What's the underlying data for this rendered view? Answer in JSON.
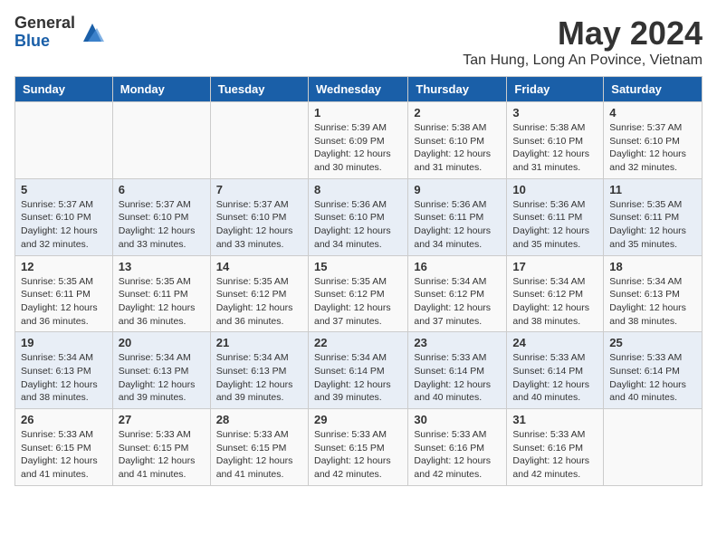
{
  "logo": {
    "general": "General",
    "blue": "Blue"
  },
  "title": "May 2024",
  "subtitle": "Tan Hung, Long An Povince, Vietnam",
  "headers": [
    "Sunday",
    "Monday",
    "Tuesday",
    "Wednesday",
    "Thursday",
    "Friday",
    "Saturday"
  ],
  "weeks": [
    [
      {
        "day": "",
        "sunrise": "",
        "sunset": "",
        "daylight": ""
      },
      {
        "day": "",
        "sunrise": "",
        "sunset": "",
        "daylight": ""
      },
      {
        "day": "",
        "sunrise": "",
        "sunset": "",
        "daylight": ""
      },
      {
        "day": "1",
        "sunrise": "Sunrise: 5:39 AM",
        "sunset": "Sunset: 6:09 PM",
        "daylight": "Daylight: 12 hours and 30 minutes."
      },
      {
        "day": "2",
        "sunrise": "Sunrise: 5:38 AM",
        "sunset": "Sunset: 6:10 PM",
        "daylight": "Daylight: 12 hours and 31 minutes."
      },
      {
        "day": "3",
        "sunrise": "Sunrise: 5:38 AM",
        "sunset": "Sunset: 6:10 PM",
        "daylight": "Daylight: 12 hours and 31 minutes."
      },
      {
        "day": "4",
        "sunrise": "Sunrise: 5:37 AM",
        "sunset": "Sunset: 6:10 PM",
        "daylight": "Daylight: 12 hours and 32 minutes."
      }
    ],
    [
      {
        "day": "5",
        "sunrise": "Sunrise: 5:37 AM",
        "sunset": "Sunset: 6:10 PM",
        "daylight": "Daylight: 12 hours and 32 minutes."
      },
      {
        "day": "6",
        "sunrise": "Sunrise: 5:37 AM",
        "sunset": "Sunset: 6:10 PM",
        "daylight": "Daylight: 12 hours and 33 minutes."
      },
      {
        "day": "7",
        "sunrise": "Sunrise: 5:37 AM",
        "sunset": "Sunset: 6:10 PM",
        "daylight": "Daylight: 12 hours and 33 minutes."
      },
      {
        "day": "8",
        "sunrise": "Sunrise: 5:36 AM",
        "sunset": "Sunset: 6:10 PM",
        "daylight": "Daylight: 12 hours and 34 minutes."
      },
      {
        "day": "9",
        "sunrise": "Sunrise: 5:36 AM",
        "sunset": "Sunset: 6:11 PM",
        "daylight": "Daylight: 12 hours and 34 minutes."
      },
      {
        "day": "10",
        "sunrise": "Sunrise: 5:36 AM",
        "sunset": "Sunset: 6:11 PM",
        "daylight": "Daylight: 12 hours and 35 minutes."
      },
      {
        "day": "11",
        "sunrise": "Sunrise: 5:35 AM",
        "sunset": "Sunset: 6:11 PM",
        "daylight": "Daylight: 12 hours and 35 minutes."
      }
    ],
    [
      {
        "day": "12",
        "sunrise": "Sunrise: 5:35 AM",
        "sunset": "Sunset: 6:11 PM",
        "daylight": "Daylight: 12 hours and 36 minutes."
      },
      {
        "day": "13",
        "sunrise": "Sunrise: 5:35 AM",
        "sunset": "Sunset: 6:11 PM",
        "daylight": "Daylight: 12 hours and 36 minutes."
      },
      {
        "day": "14",
        "sunrise": "Sunrise: 5:35 AM",
        "sunset": "Sunset: 6:12 PM",
        "daylight": "Daylight: 12 hours and 36 minutes."
      },
      {
        "day": "15",
        "sunrise": "Sunrise: 5:35 AM",
        "sunset": "Sunset: 6:12 PM",
        "daylight": "Daylight: 12 hours and 37 minutes."
      },
      {
        "day": "16",
        "sunrise": "Sunrise: 5:34 AM",
        "sunset": "Sunset: 6:12 PM",
        "daylight": "Daylight: 12 hours and 37 minutes."
      },
      {
        "day": "17",
        "sunrise": "Sunrise: 5:34 AM",
        "sunset": "Sunset: 6:12 PM",
        "daylight": "Daylight: 12 hours and 38 minutes."
      },
      {
        "day": "18",
        "sunrise": "Sunrise: 5:34 AM",
        "sunset": "Sunset: 6:13 PM",
        "daylight": "Daylight: 12 hours and 38 minutes."
      }
    ],
    [
      {
        "day": "19",
        "sunrise": "Sunrise: 5:34 AM",
        "sunset": "Sunset: 6:13 PM",
        "daylight": "Daylight: 12 hours and 38 minutes."
      },
      {
        "day": "20",
        "sunrise": "Sunrise: 5:34 AM",
        "sunset": "Sunset: 6:13 PM",
        "daylight": "Daylight: 12 hours and 39 minutes."
      },
      {
        "day": "21",
        "sunrise": "Sunrise: 5:34 AM",
        "sunset": "Sunset: 6:13 PM",
        "daylight": "Daylight: 12 hours and 39 minutes."
      },
      {
        "day": "22",
        "sunrise": "Sunrise: 5:34 AM",
        "sunset": "Sunset: 6:14 PM",
        "daylight": "Daylight: 12 hours and 39 minutes."
      },
      {
        "day": "23",
        "sunrise": "Sunrise: 5:33 AM",
        "sunset": "Sunset: 6:14 PM",
        "daylight": "Daylight: 12 hours and 40 minutes."
      },
      {
        "day": "24",
        "sunrise": "Sunrise: 5:33 AM",
        "sunset": "Sunset: 6:14 PM",
        "daylight": "Daylight: 12 hours and 40 minutes."
      },
      {
        "day": "25",
        "sunrise": "Sunrise: 5:33 AM",
        "sunset": "Sunset: 6:14 PM",
        "daylight": "Daylight: 12 hours and 40 minutes."
      }
    ],
    [
      {
        "day": "26",
        "sunrise": "Sunrise: 5:33 AM",
        "sunset": "Sunset: 6:15 PM",
        "daylight": "Daylight: 12 hours and 41 minutes."
      },
      {
        "day": "27",
        "sunrise": "Sunrise: 5:33 AM",
        "sunset": "Sunset: 6:15 PM",
        "daylight": "Daylight: 12 hours and 41 minutes."
      },
      {
        "day": "28",
        "sunrise": "Sunrise: 5:33 AM",
        "sunset": "Sunset: 6:15 PM",
        "daylight": "Daylight: 12 hours and 41 minutes."
      },
      {
        "day": "29",
        "sunrise": "Sunrise: 5:33 AM",
        "sunset": "Sunset: 6:15 PM",
        "daylight": "Daylight: 12 hours and 42 minutes."
      },
      {
        "day": "30",
        "sunrise": "Sunrise: 5:33 AM",
        "sunset": "Sunset: 6:16 PM",
        "daylight": "Daylight: 12 hours and 42 minutes."
      },
      {
        "day": "31",
        "sunrise": "Sunrise: 5:33 AM",
        "sunset": "Sunset: 6:16 PM",
        "daylight": "Daylight: 12 hours and 42 minutes."
      },
      {
        "day": "",
        "sunrise": "",
        "sunset": "",
        "daylight": ""
      }
    ]
  ]
}
